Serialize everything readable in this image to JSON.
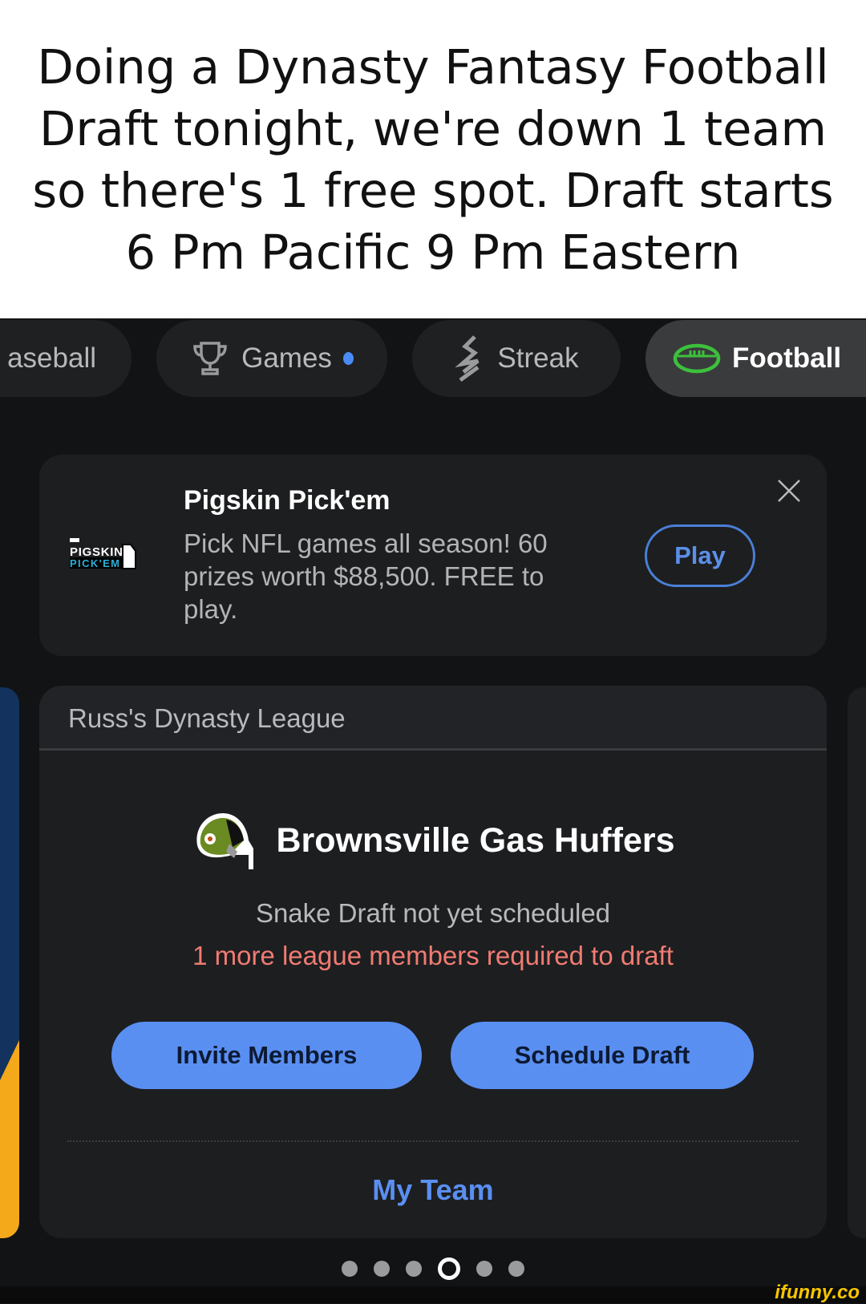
{
  "caption": "Doing a Dynasty Fantasy Football Draft tonight, we're down 1 team so there's 1 free spot. Draft starts 6 Pm Pacific 9 Pm Eastern",
  "tabs": [
    {
      "label": "aseball",
      "icon": "baseball-icon"
    },
    {
      "label": "Games",
      "icon": "trophy-icon",
      "badge": true
    },
    {
      "label": "Streak",
      "icon": "streak-icon"
    },
    {
      "label": "Football",
      "icon": "football-icon",
      "active": true
    }
  ],
  "promo": {
    "logo_text": "PIGSKIN PICK'EM",
    "title": "Pigskin Pick'em",
    "description": "Pick NFL games all season! 60 prizes worth $88,500. FREE to play.",
    "play_label": "Play"
  },
  "league": {
    "name": "Russ's Dynasty League",
    "team_name": "Brownsville Gas Huffers",
    "status": "Snake Draft not yet scheduled",
    "warning": "1 more league members required to draft",
    "invite_label": "Invite Members",
    "schedule_label": "Schedule Draft",
    "my_team_label": "My Team"
  },
  "carousel": {
    "count": 6,
    "active_index": 3
  },
  "watermark": "ifunny.co",
  "colors": {
    "accent": "#5a8ff2",
    "warning": "#f07b72",
    "football_green": "#3cc13c"
  }
}
